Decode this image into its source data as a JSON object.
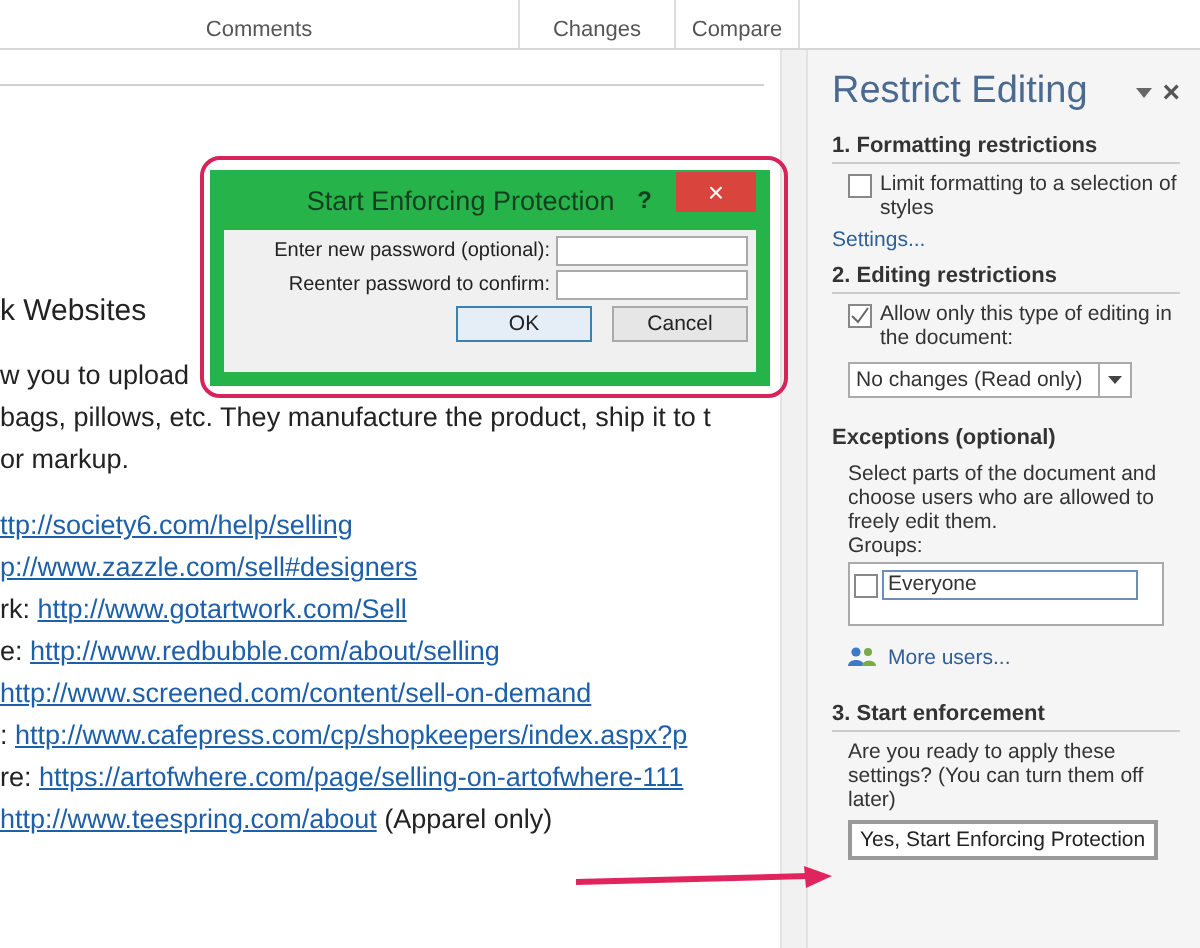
{
  "ribbon": {
    "groups": [
      {
        "label": "Comments"
      },
      {
        "label": "Changes"
      },
      {
        "label": "Compare"
      }
    ]
  },
  "document": {
    "heading": "k Websites",
    "paragraph_lines": [
      "w you to upload",
      "bags, pillows, etc. They manufacture the product, ship it to t",
      "or markup."
    ],
    "links": [
      {
        "url": "ttp://society6.com/help/selling"
      },
      {
        "url": "p://www.zazzle.com/sell#designers"
      },
      {
        "prefix": "rk: ",
        "url": "http://www.gotartwork.com/Sell"
      },
      {
        "prefix": "e: ",
        "url": "http://www.redbubble.com/about/selling"
      },
      {
        "url": "http://www.screened.com/content/sell-on-demand"
      },
      {
        "prefix": ": ",
        "url": "http://www.cafepress.com/cp/shopkeepers/index.aspx?p"
      },
      {
        "prefix": "re: ",
        "url": "https://artofwhere.com/page/selling-on-artofwhere-111"
      },
      {
        "url": "http://www.teespring.com/about",
        "suffix": " (Apparel only)"
      }
    ]
  },
  "dialog": {
    "title": "Start Enforcing Protection",
    "help": "?",
    "close": "×",
    "fields": [
      {
        "label": "Enter new password (optional):"
      },
      {
        "label": "Reenter password to confirm:"
      }
    ],
    "buttons": [
      {
        "label": "OK",
        "default": true
      },
      {
        "label": "Cancel",
        "default": false
      }
    ]
  },
  "pane": {
    "title": "Restrict Editing",
    "close": "×",
    "formatting": {
      "heading": "1. Formatting restrictions",
      "checkbox": {
        "label": "Limit formatting to a selection of styles",
        "checked": false
      },
      "link": "Settings..."
    },
    "editing": {
      "heading": "2. Editing restrictions",
      "checkbox": {
        "label": "Allow only this type of editing in the document:",
        "checked": true
      },
      "dropdown": "No changes (Read only)"
    },
    "exceptions": {
      "heading": "Exceptions (optional)",
      "description": "Select parts of the document and choose users who are allowed to freely edit them.",
      "groups_label": "Groups:",
      "groups": [
        {
          "name": "Everyone",
          "checked": false
        }
      ],
      "link": "More users..."
    },
    "enforcement": {
      "heading": "3. Start enforcement",
      "description": "Are you ready to apply these settings? (You can turn them off later)",
      "button": "Yes, Start Enforcing Protection"
    }
  }
}
